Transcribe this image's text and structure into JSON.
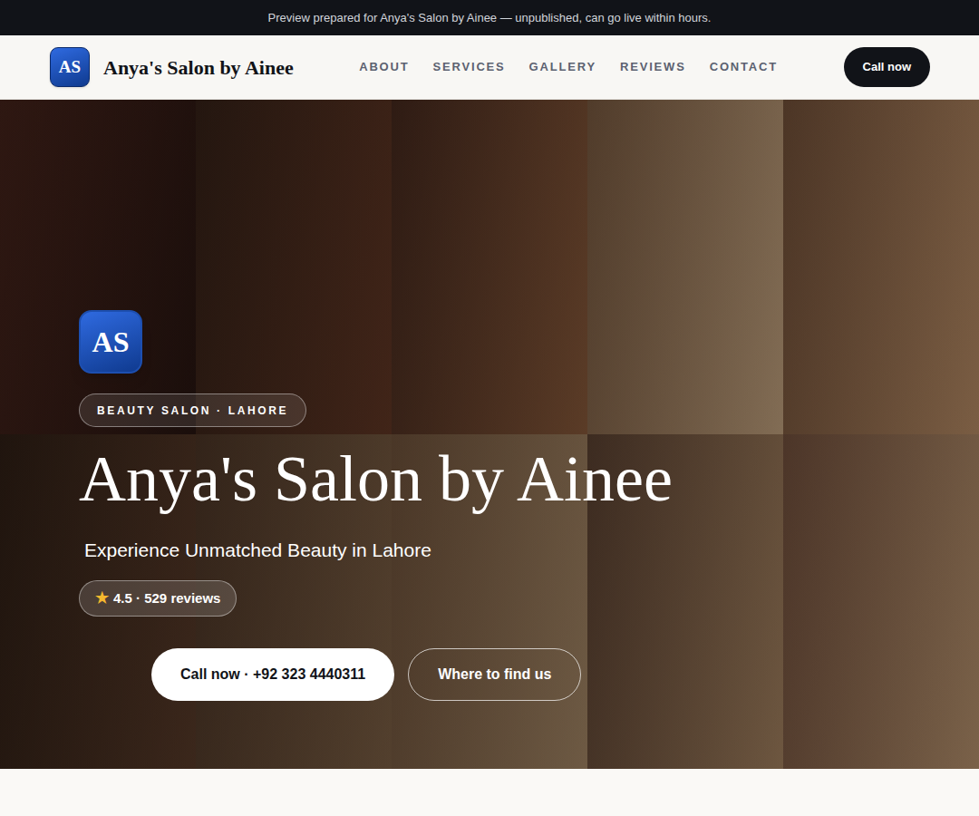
{
  "banner": "Preview prepared for Anya's Salon by Ainee — unpublished, can go live within hours.",
  "nav": {
    "logo": "AS",
    "brand": "Anya's Salon by Ainee",
    "links": [
      "ABOUT",
      "SERVICES",
      "GALLERY",
      "REVIEWS",
      "CONTACT"
    ],
    "cta": "Call now"
  },
  "hero": {
    "logo": "AS",
    "tag": "BEAUTY SALON · LAHORE",
    "title": "Anya's Salon by Ainee",
    "subtitle": "Experience Unmatched Beauty in Lahore",
    "rating": {
      "star": "★",
      "text": "4.5 · 529 reviews"
    },
    "buttons": [
      "Call now · +92 323 4440311",
      "Where to find us"
    ]
  }
}
